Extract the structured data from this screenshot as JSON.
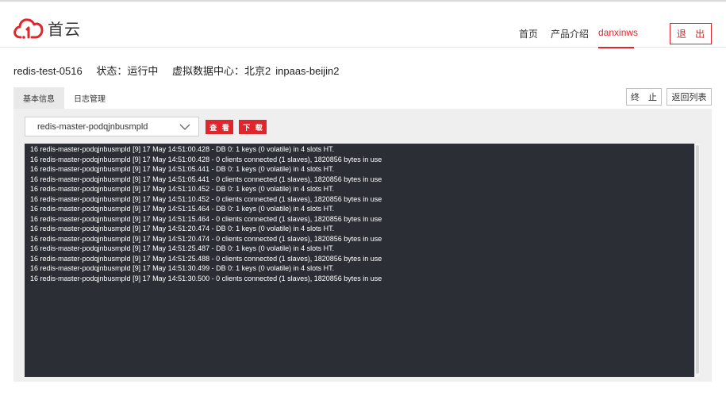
{
  "brand": {
    "name": "首云",
    "accent": "#e0262c"
  },
  "nav": {
    "home": "首页",
    "products": "产品介绍",
    "user": "danxinws",
    "logout": "退 出"
  },
  "instance": {
    "name": "redis-test-0516",
    "status_label": "状态：",
    "status_value": "运行中",
    "datacenter_label": "虚拟数据中心：",
    "datacenter_value": "北京2",
    "region": "inpaas-beijin2"
  },
  "tabs": [
    {
      "label": "基本信息",
      "active": true
    },
    {
      "label": "日志管理",
      "active": false
    }
  ],
  "actions": {
    "stop": "终 止",
    "back": "返回列表"
  },
  "log_panel": {
    "selected_pod": "redis-master-podqjnbusmpld",
    "view": "查 看",
    "download": "下 载",
    "lines": [
      "16 redis-master-podqjnbusmpld [9] 17 May 14:51:00.428 - DB 0: 1 keys (0 volatile) in 4 slots HT.",
      "16 redis-master-podqjnbusmpld [9] 17 May 14:51:00.428 - 0 clients connected (1 slaves), 1820856 bytes in use",
      "16 redis-master-podqjnbusmpld [9] 17 May 14:51:05.441 - DB 0: 1 keys (0 volatile) in 4 slots HT.",
      "16 redis-master-podqjnbusmpld [9] 17 May 14:51:05.441 - 0 clients connected (1 slaves), 1820856 bytes in use",
      "16 redis-master-podqjnbusmpld [9] 17 May 14:51:10.452 - DB 0: 1 keys (0 volatile) in 4 slots HT.",
      "16 redis-master-podqjnbusmpld [9] 17 May 14:51:10.452 - 0 clients connected (1 slaves), 1820856 bytes in use",
      "16 redis-master-podqjnbusmpld [9] 17 May 14:51:15.464 - DB 0: 1 keys (0 volatile) in 4 slots HT.",
      "16 redis-master-podqjnbusmpld [9] 17 May 14:51:15.464 - 0 clients connected (1 slaves), 1820856 bytes in use",
      "16 redis-master-podqjnbusmpld [9] 17 May 14:51:20.474 - DB 0: 1 keys (0 volatile) in 4 slots HT.",
      "16 redis-master-podqjnbusmpld [9] 17 May 14:51:20.474 - 0 clients connected (1 slaves), 1820856 bytes in use",
      "16 redis-master-podqjnbusmpld [9] 17 May 14:51:25.487 - DB 0: 1 keys (0 volatile) in 4 slots HT.",
      "16 redis-master-podqjnbusmpld [9] 17 May 14:51:25.488 - 0 clients connected (1 slaves), 1820856 bytes in use",
      "16 redis-master-podqjnbusmpld [9] 17 May 14:51:30.499 - DB 0: 1 keys (0 volatile) in 4 slots HT.",
      "16 redis-master-podqjnbusmpld [9] 17 May 14:51:30.500 - 0 clients connected (1 slaves), 1820856 bytes in use"
    ]
  }
}
